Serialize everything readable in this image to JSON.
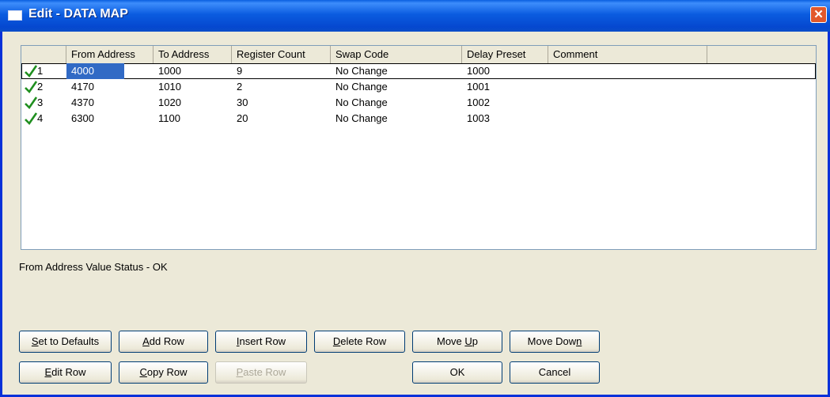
{
  "window": {
    "title": "Edit - DATA MAP",
    "close_symbol": "✕"
  },
  "grid": {
    "columns": [
      "From Address",
      "To Address",
      "Register Count",
      "Swap Code",
      "Delay Preset",
      "Comment"
    ],
    "rows": [
      {
        "num": "1",
        "from": "4000",
        "to": "1000",
        "count": "9",
        "swap": "No Change",
        "delay": "1000",
        "comment": ""
      },
      {
        "num": "2",
        "from": "4170",
        "to": "1010",
        "count": "2",
        "swap": "No Change",
        "delay": "1001",
        "comment": ""
      },
      {
        "num": "3",
        "from": "4370",
        "to": "1020",
        "count": "30",
        "swap": "No Change",
        "delay": "1002",
        "comment": ""
      },
      {
        "num": "4",
        "from": "6300",
        "to": "1100",
        "count": "20",
        "swap": "No Change",
        "delay": "1003",
        "comment": ""
      }
    ]
  },
  "status": "From Address Value Status - OK",
  "buttons": {
    "set_defaults": {
      "pre": "",
      "u": "S",
      "post": "et to Defaults"
    },
    "add_row": {
      "pre": "",
      "u": "A",
      "post": "dd Row"
    },
    "insert_row": {
      "pre": "",
      "u": "I",
      "post": "nsert Row"
    },
    "delete_row": {
      "pre": "",
      "u": "D",
      "post": "elete Row"
    },
    "move_up": {
      "pre": "Move ",
      "u": "U",
      "post": "p"
    },
    "move_down": {
      "pre": "Move Dow",
      "u": "n",
      "post": ""
    },
    "edit_row": {
      "pre": "",
      "u": "E",
      "post": "dit Row"
    },
    "copy_row": {
      "pre": "",
      "u": "C",
      "post": "opy Row"
    },
    "paste_row": {
      "pre": "",
      "u": "P",
      "post": "aste Row"
    },
    "ok": {
      "pre": "OK",
      "u": "",
      "post": ""
    },
    "cancel": {
      "pre": "Cancel",
      "u": "",
      "post": ""
    }
  }
}
